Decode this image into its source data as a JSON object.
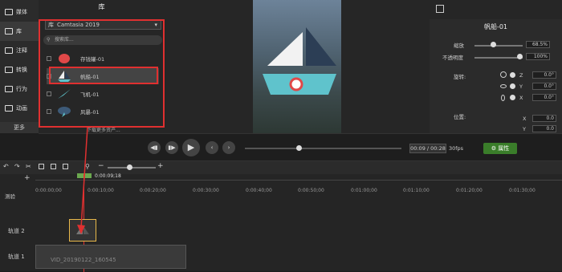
{
  "tools": {
    "items": [
      {
        "label": "媒体",
        "icon": "film-icon"
      },
      {
        "label": "库",
        "icon": "books-icon"
      },
      {
        "label": "注释",
        "icon": "callout-icon"
      },
      {
        "label": "转换",
        "icon": "transition-icon"
      },
      {
        "label": "行为",
        "icon": "behavior-icon"
      },
      {
        "label": "动画",
        "icon": "animation-icon"
      }
    ],
    "more": "更多"
  },
  "library": {
    "title": "库",
    "select_prefix": "库",
    "selected": "Camtasia 2019",
    "search_placeholder": "搜索库...",
    "items": [
      {
        "label": "存钱罐-01"
      },
      {
        "label": "帆船-01"
      },
      {
        "label": "飞机-01"
      },
      {
        "label": "风暴-01"
      }
    ],
    "more_assets": "下载更多资产..."
  },
  "props": {
    "title": "帆船-01",
    "scale_label": "缩放",
    "scale_value": "68.5%",
    "scale_fraction": 0.36,
    "opacity_label": "不透明度",
    "opacity_value": "100%",
    "opacity_fraction": 1.0,
    "rotation_label": "旋转:",
    "rot_z_label": "Z",
    "rot_z": "0.0°",
    "rot_y_label": "Y",
    "rot_y": "0.0°",
    "rot_x_label": "X",
    "rot_x": "0.0°",
    "position_label": "位置:",
    "pos_x_label": "X",
    "pos_x": "0.0",
    "pos_y_label": "Y",
    "pos_y": "0.0"
  },
  "playback": {
    "time": "00:09 / 00:28",
    "fps": "30fps",
    "progress_fraction": 0.33,
    "props_button": "属性"
  },
  "timeline": {
    "playhead": "0:00:09;18",
    "ticks": [
      "0:00:00;00",
      "0:00:10;00",
      "0:00:20;00",
      "0:00:30;00",
      "0:00:40;00",
      "0:00:50;00",
      "0:01:00;00",
      "0:01:10;00",
      "0:01:20;00",
      "0:01:30;00"
    ],
    "marker_label": "测验",
    "track2": "轨道 2",
    "track1": "轨道 1",
    "clip1": "VID_20190122_160545"
  }
}
